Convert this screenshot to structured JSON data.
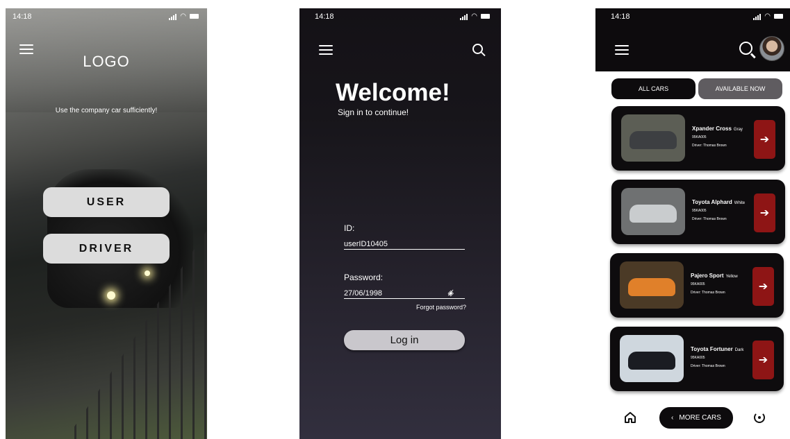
{
  "screens": {
    "splash": {
      "time": "14:18",
      "logo": "LOGO",
      "tagline": "Use the company car sufficiently!",
      "user_button": "USER",
      "driver_button": "DRIVER"
    },
    "login": {
      "time": "14:18",
      "welcome": "Welcome!",
      "subtitle": "Sign in to continue!",
      "id_label": "ID:",
      "id_value": "userID10405",
      "password_label": "Password:",
      "password_value": "27/06/1998",
      "forgot": "Forgot password?",
      "login_button": "Log in"
    },
    "cars": {
      "time": "14:18",
      "tabs": [
        {
          "label": "ALL CARS",
          "active": true
        },
        {
          "label": "AVAILABLE NOW",
          "active": false
        }
      ],
      "list": [
        {
          "name": "Xpander Cross",
          "color": "Gray",
          "plate": "95KA005",
          "driver": "Driver: Thomas Brown",
          "thumb_bg": "#5c5e55",
          "car_color": "#3d3f42"
        },
        {
          "name": "Toyota Alphard",
          "color": "White",
          "plate": "95KA005",
          "driver": "Driver: Thomas Brown",
          "thumb_bg": "#6f7172",
          "car_color": "#c9ccce"
        },
        {
          "name": "Pajero Sport",
          "color": "Yellow",
          "plate": "95KA005",
          "driver": "Driver: Thomas Brown",
          "thumb_bg": "#4b3a26",
          "car_color": "#e0802a"
        },
        {
          "name": "Toyota Fortuner",
          "color": "Dark",
          "plate": "95KA005",
          "driver": "Driver: Thomas Brown",
          "thumb_bg": "#cfd7de",
          "car_color": "#1a1c22"
        }
      ],
      "more_button": "MORE CARS"
    }
  }
}
